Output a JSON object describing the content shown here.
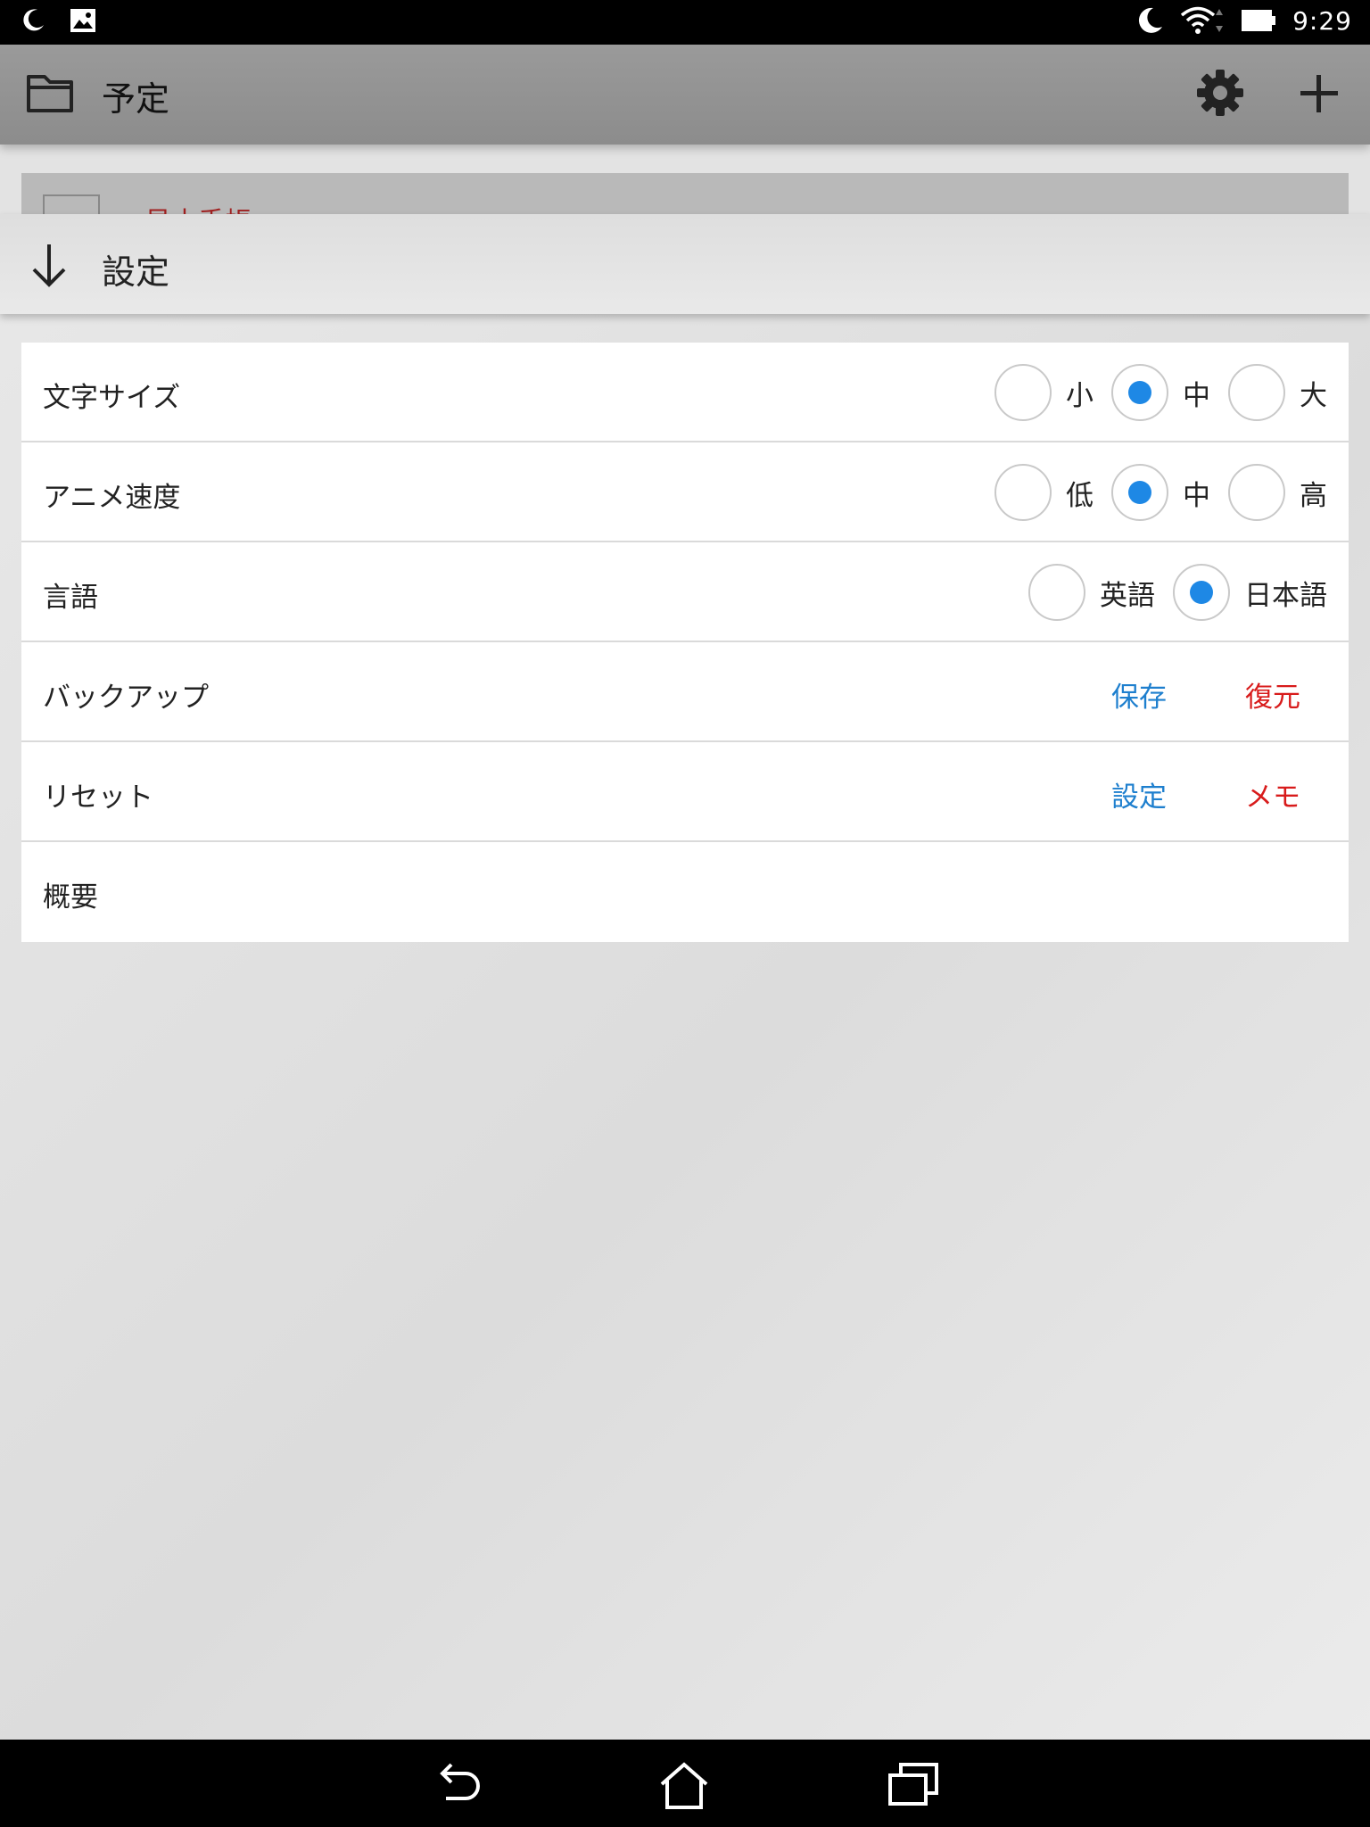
{
  "status_bar": {
    "time": "9:29",
    "left_icons": [
      "moon-icon",
      "image-icon"
    ],
    "right_icons": [
      "moon-icon",
      "wifi-icon",
      "battery-icon"
    ]
  },
  "app_bar": {
    "title": "予定",
    "icons": [
      "folder-icon",
      "gear-icon",
      "plus-icon"
    ]
  },
  "background_list": {
    "first_item_text": "見本手帳"
  },
  "settings_sheet": {
    "title": "設定",
    "rows": [
      {
        "label": "文字サイズ",
        "options": [
          "小",
          "中",
          "大"
        ],
        "selected": "中"
      },
      {
        "label": "アニメ速度",
        "options": [
          "低",
          "中",
          "高"
        ],
        "selected": "中"
      },
      {
        "label": "言語",
        "options": [
          "英語",
          "日本語"
        ],
        "selected": "日本語"
      },
      {
        "label": "バックアップ",
        "actions": [
          "保存",
          "復元"
        ]
      },
      {
        "label": "リセット",
        "actions": [
          "設定",
          "メモ"
        ]
      },
      {
        "label": "概要"
      }
    ]
  },
  "colors": {
    "accent_blue": "#1e88e5",
    "link_blue": "#1e7fce",
    "link_red": "#d81b1b"
  },
  "nav_bar": {
    "icons": [
      "back-icon",
      "home-icon",
      "recent-apps-icon"
    ]
  }
}
